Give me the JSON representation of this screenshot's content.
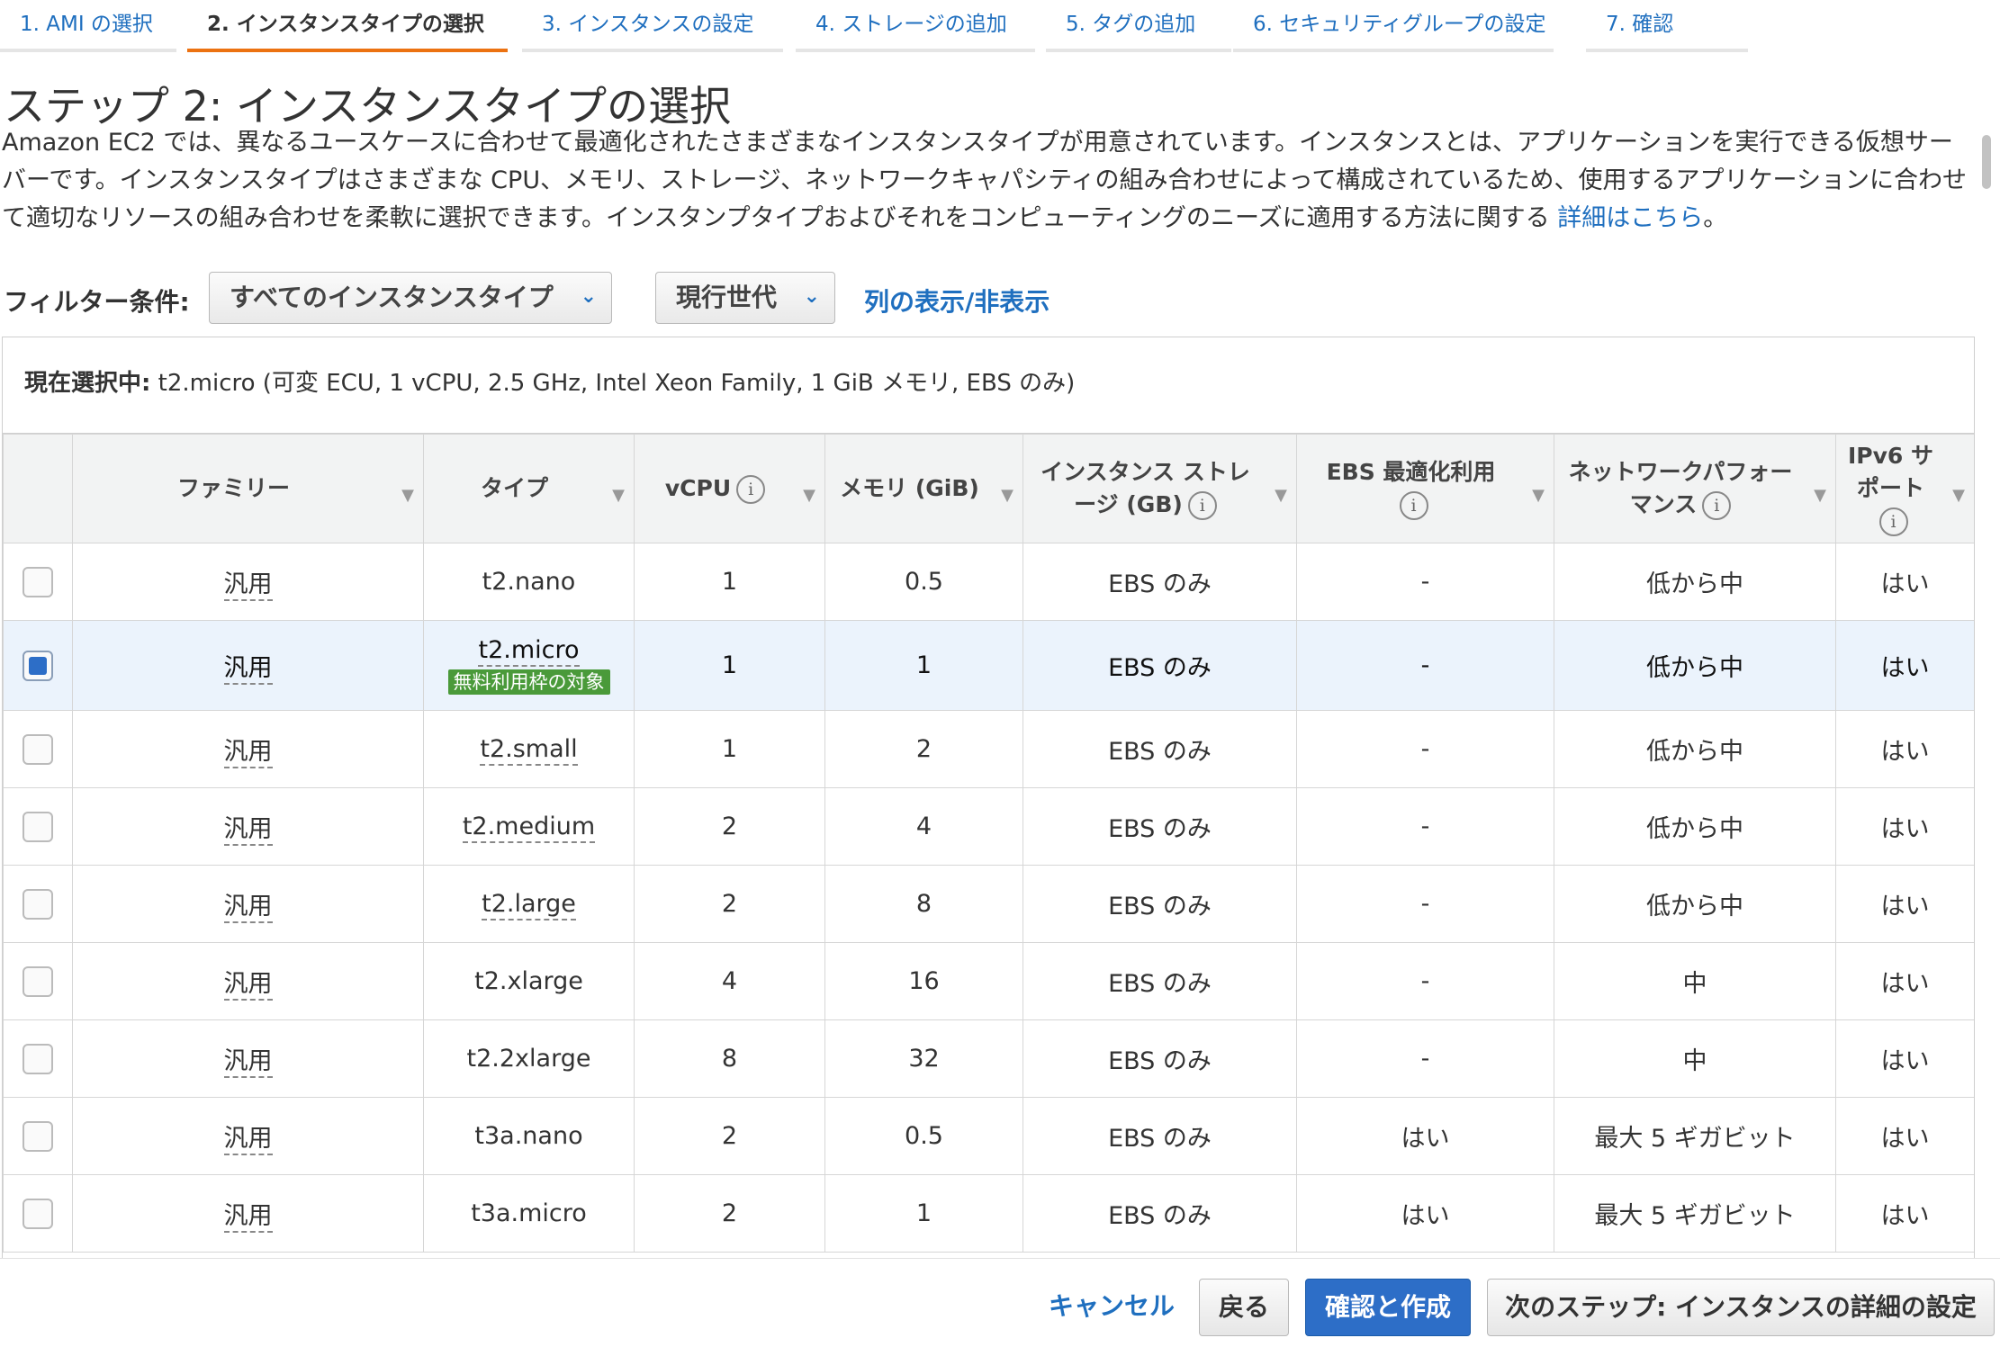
{
  "steps": [
    {
      "label": "1. AMI の選択",
      "active": false
    },
    {
      "label": "2. インスタンスタイプの選択",
      "active": true
    },
    {
      "label": "3. インスタンスの設定",
      "active": false
    },
    {
      "label": "4. ストレージの追加",
      "active": false
    },
    {
      "label": "5. タグの追加",
      "active": false
    },
    {
      "label": "6. セキュリティグループの設定",
      "active": false
    },
    {
      "label": "7. 確認",
      "active": false
    }
  ],
  "page_title": "ステップ 2: インスタンスタイプの選択",
  "description": {
    "text": "Amazon EC2 では、異なるユースケースに合わせて最適化されたさまざまなインスタンスタイプが用意されています。インスタンスとは、アプリケーションを実行できる仮想サーバーです。インスタンスタイプはさまざまな CPU、メモリ、ストレージ、ネットワークキャパシティの組み合わせによって構成されているため、使用するアプリケーションに合わせて適切なリソースの組み合わせを柔軟に選択できます。インスタンプタイプおよびそれをコンピューティングのニーズに適用する方法に関する ",
    "link": "詳細はこちら",
    "suffix": "。"
  },
  "filter": {
    "label": "フィルター条件:",
    "instance_type_select": "すべてのインスタンスタイプ",
    "generation_select": "現行世代",
    "columns_link": "列の表示/非表示"
  },
  "current_selection": {
    "label": "現在選択中:",
    "value": " t2.micro (可変 ECU, 1 vCPU, 2.5 GHz, Intel Xeon Family, 1 GiB メモリ, EBS のみ)"
  },
  "table": {
    "headers": {
      "family": "ファミリー",
      "type": "タイプ",
      "vcpu": "vCPU",
      "memory": "メモリ (GiB)",
      "storage_1": "インスタンス ストレ",
      "storage_2": "ージ (GB)",
      "ebs": "EBS 最適化利用",
      "network_1": "ネットワークパフォー",
      "network_2": "マンス",
      "ipv6_1": "IPv6 サ",
      "ipv6_2": "ポート",
      "info_glyph": "i"
    },
    "free_tier_badge": "無料利用枠の対象",
    "rows": [
      {
        "family": "汎用",
        "type": "t2.nano",
        "vcpu": "1",
        "memory": "0.5",
        "storage": "EBS のみ",
        "ebs": "-",
        "network": "低から中",
        "ipv6": "はい"
      },
      {
        "family": "汎用",
        "type": "t2.micro",
        "vcpu": "1",
        "memory": "1",
        "storage": "EBS のみ",
        "ebs": "-",
        "network": "低から中",
        "ipv6": "はい"
      },
      {
        "family": "汎用",
        "type": "t2.small",
        "vcpu": "1",
        "memory": "2",
        "storage": "EBS のみ",
        "ebs": "-",
        "network": "低から中",
        "ipv6": "はい"
      },
      {
        "family": "汎用",
        "type": "t2.medium",
        "vcpu": "2",
        "memory": "4",
        "storage": "EBS のみ",
        "ebs": "-",
        "network": "低から中",
        "ipv6": "はい"
      },
      {
        "family": "汎用",
        "type": "t2.large",
        "vcpu": "2",
        "memory": "8",
        "storage": "EBS のみ",
        "ebs": "-",
        "network": "低から中",
        "ipv6": "はい"
      },
      {
        "family": "汎用",
        "type": "t2.xlarge",
        "vcpu": "4",
        "memory": "16",
        "storage": "EBS のみ",
        "ebs": "-",
        "network": "中",
        "ipv6": "はい"
      },
      {
        "family": "汎用",
        "type": "t2.2xlarge",
        "vcpu": "8",
        "memory": "32",
        "storage": "EBS のみ",
        "ebs": "-",
        "network": "中",
        "ipv6": "はい"
      },
      {
        "family": "汎用",
        "type": "t3a.nano",
        "vcpu": "2",
        "memory": "0.5",
        "storage": "EBS のみ",
        "ebs": "はい",
        "network": "最大 5 ギガビット",
        "ipv6": "はい"
      },
      {
        "family": "汎用",
        "type": "t3a.micro",
        "vcpu": "2",
        "memory": "1",
        "storage": "EBS のみ",
        "ebs": "はい",
        "network": "最大 5 ギガビット",
        "ipv6": "はい"
      }
    ]
  },
  "footer": {
    "cancel": "キャンセル",
    "back": "戻る",
    "review": "確認と作成",
    "next": "次のステップ: インスタンスの詳細の設定"
  },
  "colors": {
    "link": "#1f6fbf",
    "active_tab_underline": "#ec7211",
    "primary_button": "#2d6ec7",
    "free_tier_badge": "#4a9a3a",
    "selected_row": "#ebf3fc"
  }
}
